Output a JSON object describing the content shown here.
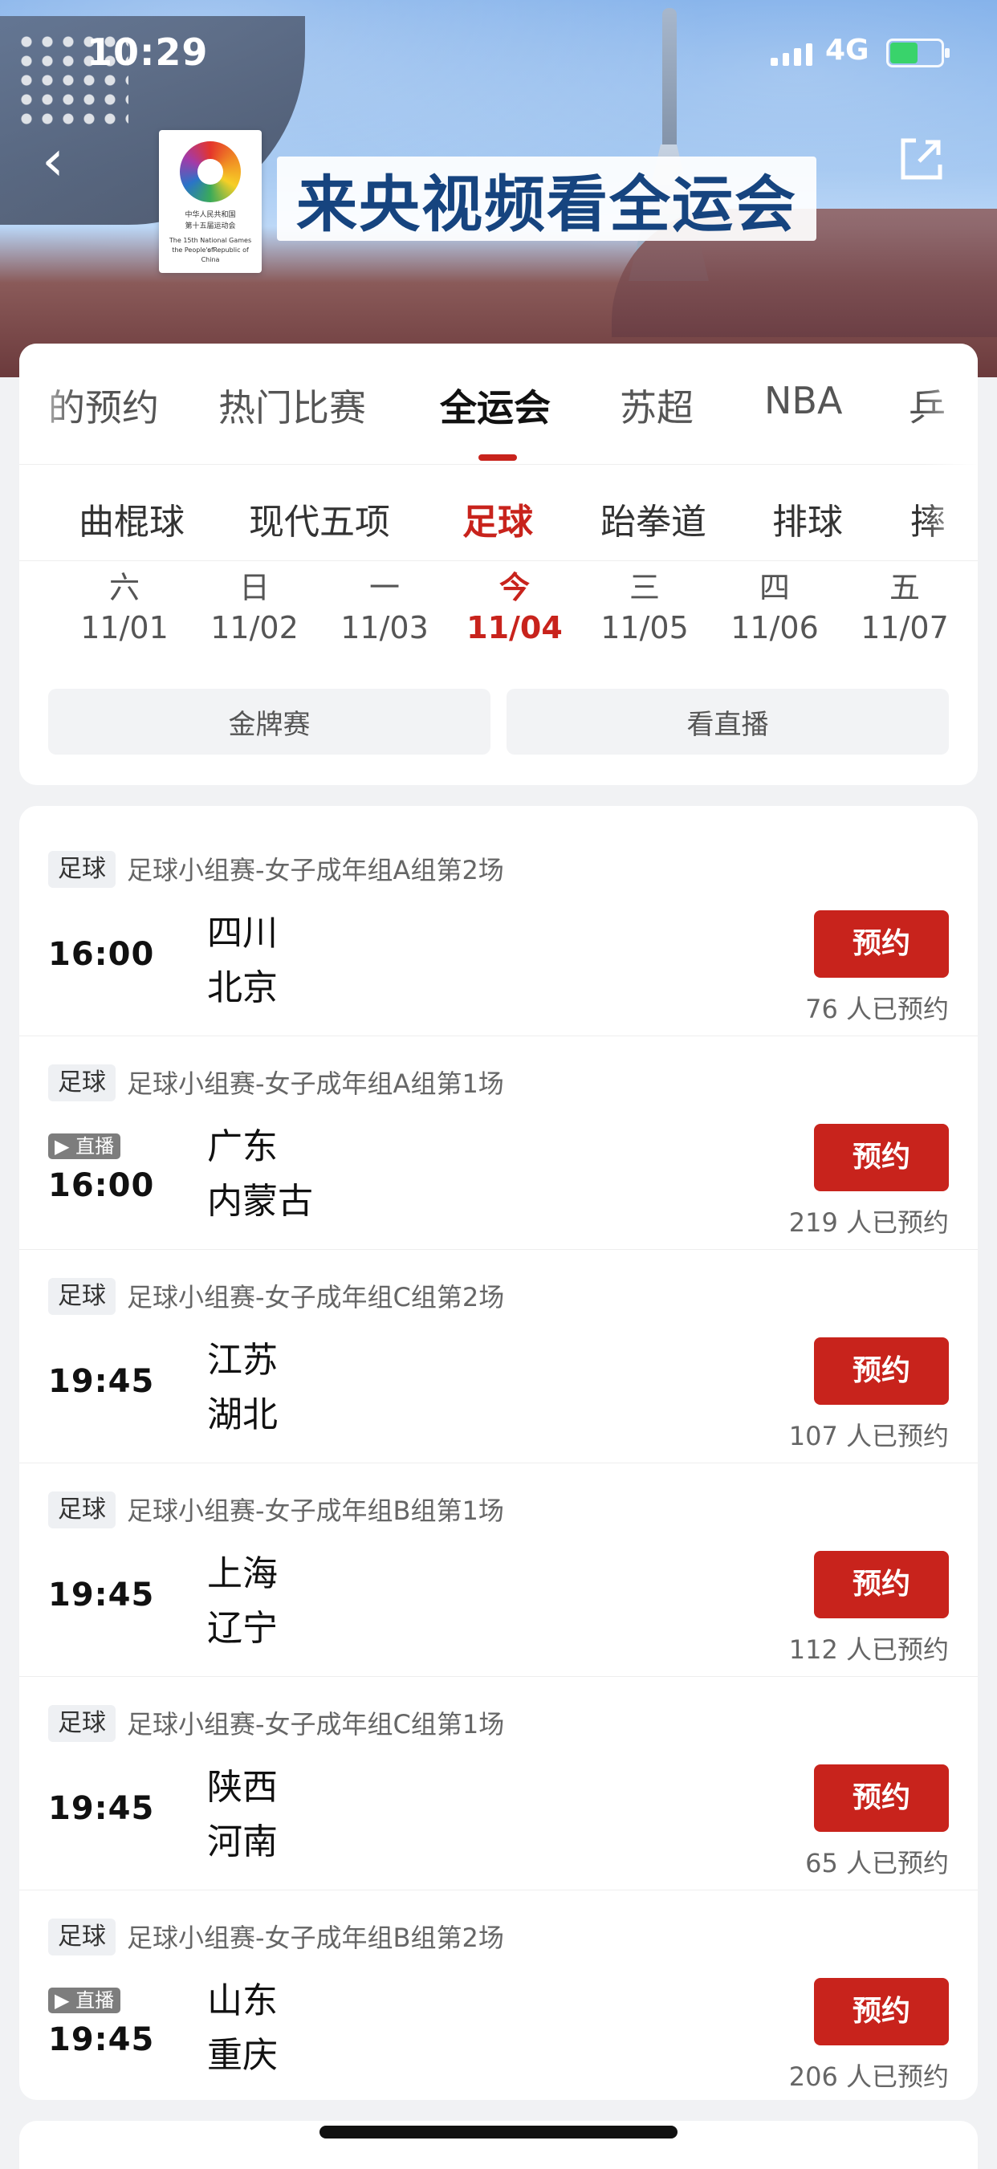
{
  "status": {
    "time": "10:29",
    "network": "4G"
  },
  "hero": {
    "title": "来央视频看全运会",
    "logo_lines": [
      "中华人民共和国",
      "第十五届运动会",
      "The 15th National Games of",
      "the People's Republic of China"
    ]
  },
  "tabs": {
    "main": [
      "的预约",
      "热门比赛",
      "全运会",
      "苏超",
      "NBA",
      "乒"
    ],
    "main_active_index": 2,
    "sub": [
      "曲棍球",
      "现代五项",
      "足球",
      "跆拳道",
      "排球",
      "摔"
    ],
    "sub_active_index": 2
  },
  "dates": [
    {
      "week": "六",
      "date": "11/01",
      "active": false
    },
    {
      "week": "日",
      "date": "11/02",
      "active": false
    },
    {
      "week": "一",
      "date": "11/03",
      "active": false
    },
    {
      "week": "今",
      "date": "11/04",
      "active": true
    },
    {
      "week": "三",
      "date": "11/05",
      "active": false
    },
    {
      "week": "四",
      "date": "11/06",
      "active": false
    },
    {
      "week": "五",
      "date": "11/07",
      "active": false
    }
  ],
  "filters": [
    "金牌赛",
    "看直播"
  ],
  "matches": [
    {
      "tag": "足球",
      "title": "足球小组赛-女子成年组A组第2场",
      "time": "16:00",
      "team1": "四川",
      "team2": "北京",
      "button": "预约",
      "count": "76 人已预约",
      "live": ""
    },
    {
      "tag": "足球",
      "title": "足球小组赛-女子成年组A组第1场",
      "time": "16:00",
      "team1": "广东",
      "team2": "内蒙古",
      "button": "预约",
      "count": "219 人已预约",
      "live": "▶ 直播"
    },
    {
      "tag": "足球",
      "title": "足球小组赛-女子成年组C组第2场",
      "time": "19:45",
      "team1": "江苏",
      "team2": "湖北",
      "button": "预约",
      "count": "107 人已预约",
      "live": ""
    },
    {
      "tag": "足球",
      "title": "足球小组赛-女子成年组B组第1场",
      "time": "19:45",
      "team1": "上海",
      "team2": "辽宁",
      "button": "预约",
      "count": "112 人已预约",
      "live": ""
    },
    {
      "tag": "足球",
      "title": "足球小组赛-女子成年组C组第1场",
      "time": "19:45",
      "team1": "陕西",
      "team2": "河南",
      "button": "预约",
      "count": "65 人已预约",
      "live": ""
    },
    {
      "tag": "足球",
      "title": "足球小组赛-女子成年组B组第2场",
      "time": "19:45",
      "team1": "山东",
      "team2": "重庆",
      "button": "预约",
      "count": "206 人已预约",
      "live": "▶ 直播"
    }
  ],
  "colors": {
    "accent": "#c8231c",
    "title_blue": "#16447f"
  },
  "icons": {
    "back": "back-icon",
    "share": "share-icon"
  }
}
